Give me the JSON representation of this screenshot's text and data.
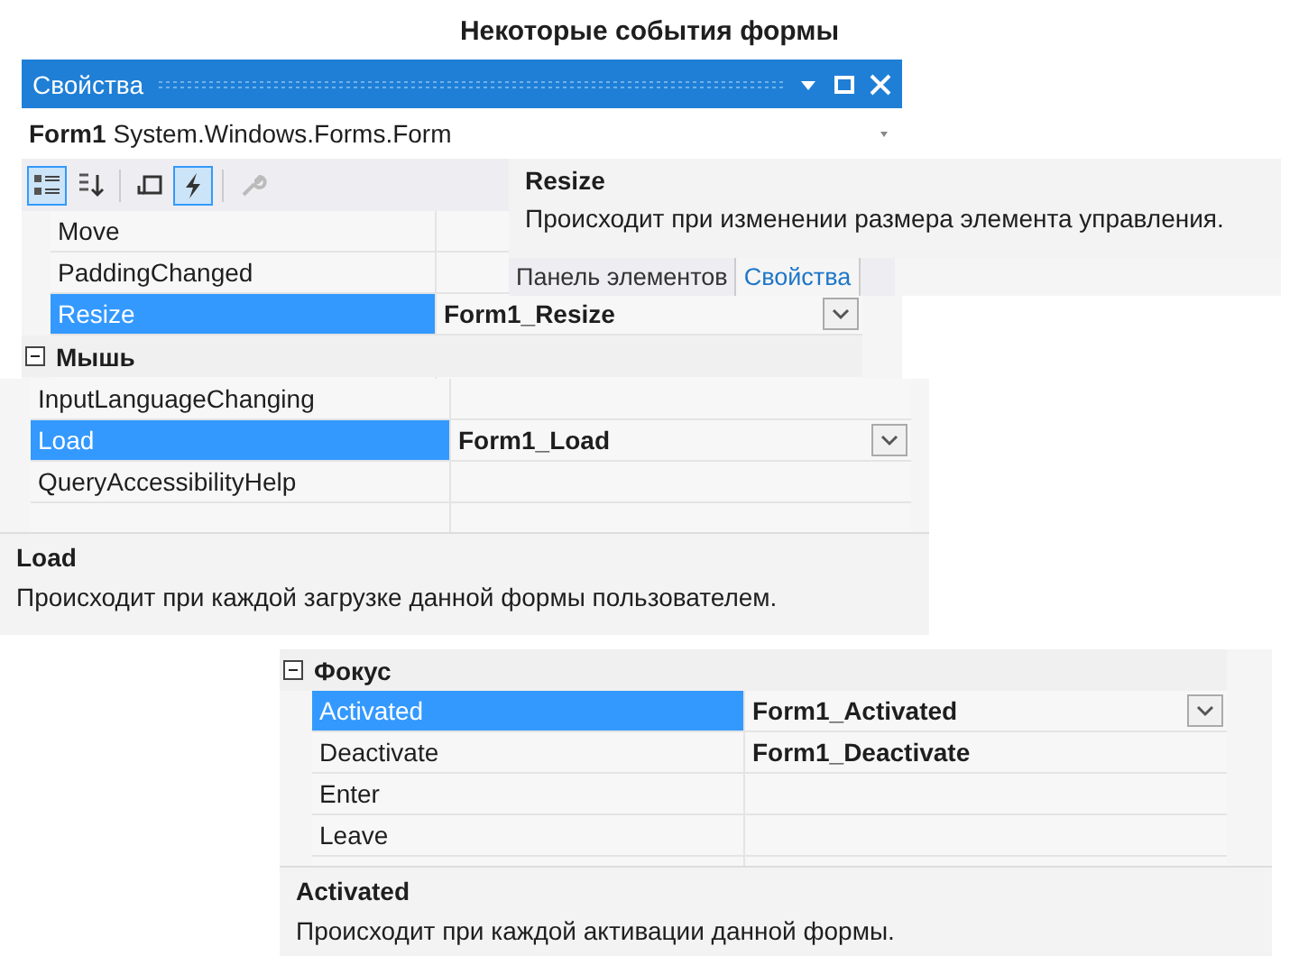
{
  "slide_title": "Некоторые события формы",
  "fragments": [
    {
      "kind": "panel",
      "title": "Свойства",
      "object": {
        "name": "Form1",
        "type": "System.Windows.Forms.Form"
      },
      "toolbar": [
        {
          "kind": "categorized",
          "selected": true,
          "disabled": false
        },
        {
          "kind": "alphabetical",
          "selected": false,
          "disabled": false
        },
        {
          "kind": "properties",
          "selected": false,
          "disabled": false
        },
        {
          "kind": "events",
          "selected": true,
          "disabled": false
        },
        {
          "kind": "pages",
          "selected": false,
          "disabled": true
        }
      ],
      "rows": [
        {
          "kind": "event",
          "name": "Move",
          "selected": false
        },
        {
          "kind": "event",
          "name": "PaddingChanged",
          "selected": false
        },
        {
          "kind": "event",
          "name": "Resize",
          "value": "Form1_Resize",
          "selected": true
        },
        {
          "kind": "category",
          "name": "Мышь",
          "expanded": true
        }
      ]
    },
    {
      "kind": "help",
      "description": {
        "title": "Resize",
        "text": "Происходит при изменении размера элемента управления."
      },
      "tabs": [
        {
          "label": "Панель элементов",
          "selected": false
        },
        {
          "label": "Свойства",
          "selected": true
        }
      ]
    },
    {
      "kind": "grid",
      "rows": [
        {
          "kind": "event",
          "name": "InputLanguageChanging",
          "selected": false
        },
        {
          "kind": "event",
          "name": "Load",
          "value": "Form1_Load",
          "selected": true
        },
        {
          "kind": "event",
          "name": "QueryAccessibilityHelp",
          "selected": false
        }
      ],
      "description": {
        "title": "Load",
        "text": "Происходит при каждой загрузке данной формы пользователем."
      }
    },
    {
      "kind": "grid",
      "rows": [
        {
          "kind": "category",
          "name": "Фокус",
          "expanded": true
        },
        {
          "kind": "event",
          "name": "Activated",
          "value": "Form1_Activated",
          "selected": true
        },
        {
          "kind": "event",
          "name": "Deactivate",
          "value": "Form1_Deactivate",
          "selected": false
        },
        {
          "kind": "event",
          "name": "Enter",
          "selected": false
        },
        {
          "kind": "event",
          "name": "Leave",
          "selected": false
        }
      ],
      "description": {
        "title": "Activated",
        "text": "Происходит при каждой активации данной формы."
      }
    }
  ]
}
